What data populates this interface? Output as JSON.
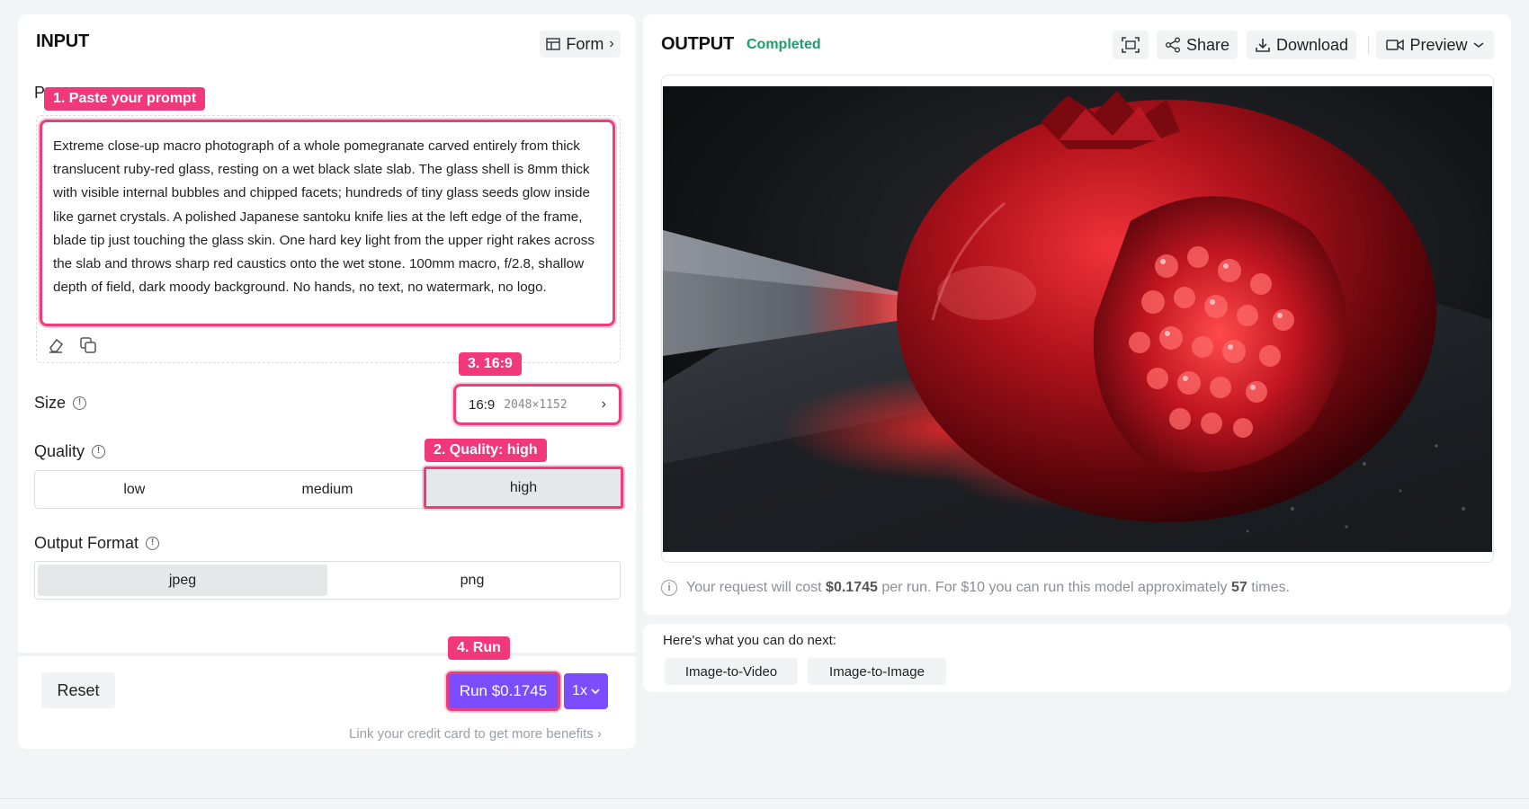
{
  "input": {
    "title": "INPUT",
    "form_button": "Form",
    "prompt_label_partial": "P",
    "prompt_text": "Extreme close-up macro photograph of a whole pomegranate carved entirely from thick translucent ruby-red glass, resting on a wet black slate slab. The glass shell is 8mm thick with visible internal bubbles and chipped facets; hundreds of tiny glass seeds glow inside like garnet crystals. A polished Japanese santoku knife lies at the left edge of the frame, blade tip just touching the glass skin. One hard key light from the upper right rakes across the slab and throws sharp red caustics onto the wet stone. 100mm macro, f/2.8, shallow depth of field, dark moody background. No hands, no text, no watermark, no logo.",
    "size_label": "Size",
    "size_ratio": "16:9",
    "size_dims": "2048×1152",
    "quality_label": "Quality",
    "quality_options": [
      "low",
      "medium",
      "high"
    ],
    "quality_selected": "high",
    "format_label": "Output Format",
    "format_options": [
      "jpeg",
      "png"
    ],
    "format_selected": "jpeg",
    "reset_label": "Reset",
    "run_label": "Run $0.1745",
    "multiplier_label": "1x",
    "credit_link": "Link your credit card to get more benefits"
  },
  "callouts": {
    "prompt": "1. Paste your prompt",
    "quality": "2. Quality: high",
    "size": "3. 16:9",
    "run": "4. Run"
  },
  "output": {
    "title": "OUTPUT",
    "status": "Completed",
    "share_label": "Share",
    "download_label": "Download",
    "preview_label": "Preview",
    "cost_prefix": "Your request will cost",
    "cost_value": "$0.1745",
    "cost_middle": "per run. For $10 you can run this model approximately",
    "cost_count": "57",
    "cost_suffix": "times."
  },
  "next": {
    "title": "Here's what you can do next:",
    "buttons": [
      "Image-to-Video",
      "Image-to-Image"
    ]
  },
  "colors": {
    "accent": "#7c4dff",
    "callout": "#f0387a",
    "status": "#1f9d6a"
  }
}
